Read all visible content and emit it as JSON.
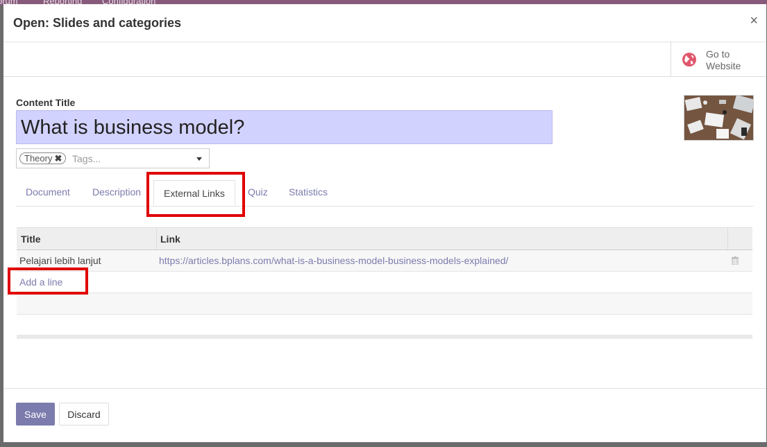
{
  "background_menu": [
    "orum",
    "Reporting",
    "Configuration"
  ],
  "dialog": {
    "title": "Open: Slides and categories",
    "close_symbol": "×"
  },
  "button_box": {
    "website_label": "Go to Website",
    "icon": "globe-icon"
  },
  "form": {
    "content_title_label": "Content Title",
    "content_title_value": "What is business model?",
    "tags": [
      "Theory"
    ],
    "tags_placeholder": "Tags...",
    "thumbnail": "business-desk-image"
  },
  "tabs": [
    {
      "label": "Document",
      "active": false
    },
    {
      "label": "Description",
      "active": false
    },
    {
      "label": "External Links",
      "active": true
    },
    {
      "label": "Quiz",
      "active": false
    },
    {
      "label": "Statistics",
      "active": false
    }
  ],
  "links_table": {
    "columns": [
      "Title",
      "Link"
    ],
    "rows": [
      {
        "title": "Pelajari lebih lanjut",
        "link": "https://articles.bplans.com/what-is-a-business-model-business-models-explained/"
      }
    ],
    "add_line_label": "Add a line"
  },
  "footer": {
    "save_label": "Save",
    "discard_label": "Discard"
  },
  "colors": {
    "accent": "#7c7bad",
    "title_input_bg": "#d2d2ff",
    "highlight": "#e00000"
  }
}
